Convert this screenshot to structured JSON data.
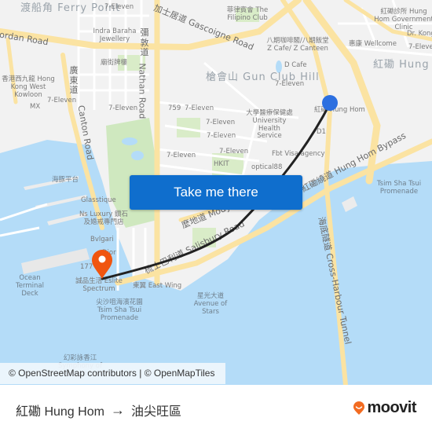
{
  "map": {
    "area_labels": [
      {
        "id": "ferry-point",
        "text": "渡船角 Ferry Point"
      },
      {
        "id": "gun-club-hill",
        "text": "槍會山 Gun Club Hill"
      },
      {
        "id": "hung-hom",
        "text": "紅磡 Hung Hom"
      }
    ],
    "road_labels": [
      {
        "id": "jordan-road",
        "text": "Jordan Road"
      },
      {
        "id": "gascoigne-road",
        "text": "加士居道 Gascoigne Road"
      },
      {
        "id": "nathan-road-cn",
        "text": "彌敦道"
      },
      {
        "id": "nathan-road",
        "text": "Nathan Road"
      },
      {
        "id": "canton-road-cn",
        "text": "廣東道"
      },
      {
        "id": "canton-road",
        "text": "Canton Road"
      },
      {
        "id": "hung-hom-bypass",
        "text": "紅磡繞道 Hung Hom Bypass"
      },
      {
        "id": "mody-road",
        "text": "麼地道 Mody Road"
      },
      {
        "id": "salisbury-road",
        "text": "梳士巴利道 Salisbury Road"
      },
      {
        "id": "cross-harbour-tunnel",
        "text": "海底隧道 Cross-Harbour Tunnel"
      }
    ],
    "poi_labels": [
      {
        "id": "7eleven-1",
        "text": "7-Eleven"
      },
      {
        "id": "indra",
        "text": "Indra Baraha Jewellery"
      },
      {
        "id": "temple-st",
        "text": "廟街牌樓"
      },
      {
        "id": "filipino-club",
        "text": "菲律賓會 The Filipino Club"
      },
      {
        "id": "z-cafe",
        "text": "八期咖啡閣/八期飯堂 Z Cafe/ Z Canteen"
      },
      {
        "id": "hung-hom-clinic",
        "text": "紅磡診所 Hung Hom Government Clinic"
      },
      {
        "id": "dr-kong",
        "text": "Dr. Kong"
      },
      {
        "id": "wellcome",
        "text": "惠康 Wellcome"
      },
      {
        "id": "7eleven-2",
        "text": "7-Eleven"
      },
      {
        "id": "d-cafe",
        "text": "D Cafe"
      },
      {
        "id": "7eleven-3",
        "text": "7-Eleven"
      },
      {
        "id": "hk-west-kowloon",
        "text": "香港西九龍 Hong Kong West Kowloon"
      },
      {
        "id": "7eleven-4",
        "text": "7-Eleven"
      },
      {
        "id": "mx",
        "text": "MX"
      },
      {
        "id": "7eleven-5",
        "text": "7-Eleven"
      },
      {
        "id": "759",
        "text": "759"
      },
      {
        "id": "7eleven-6",
        "text": "7-Eleven"
      },
      {
        "id": "uhs",
        "text": "大學醫療保健處 University Health Service"
      },
      {
        "id": "hung-hom-station",
        "text": "紅磡 Hung Hom"
      },
      {
        "id": "7eleven-7",
        "text": "7-Eleven"
      },
      {
        "id": "7eleven-8",
        "text": "7-Eleven"
      },
      {
        "id": "d1",
        "text": "D1"
      },
      {
        "id": "7eleven-9",
        "text": "7-Eleven"
      },
      {
        "id": "7eleven-10",
        "text": "7-Eleven"
      },
      {
        "id": "fbt-visa",
        "text": "Fbt Visa agency"
      },
      {
        "id": "hkit",
        "text": "HKIT"
      },
      {
        "id": "optical88",
        "text": "optical88"
      },
      {
        "id": "dolphin-terrace",
        "text": "海豚平台"
      },
      {
        "id": "glasstique",
        "text": "Glasstique"
      },
      {
        "id": "ns-luxury",
        "text": "Ns Luxury 鑽石及婚戒專門店"
      },
      {
        "id": "bvlgari",
        "text": "Bvlgari"
      },
      {
        "id": "dior",
        "text": "Dior"
      },
      {
        "id": "177",
        "text": "177"
      },
      {
        "id": "ocean-terminal",
        "text": "Ocean Terminal Deck"
      },
      {
        "id": "eslite",
        "text": "誠品生活 Eslite Spectrum"
      },
      {
        "id": "east-wing",
        "text": "東翼 East Wing"
      },
      {
        "id": "tst-promenade-1",
        "text": "尖沙咀海濱花園 Tsim Sha Tsui Promenade"
      },
      {
        "id": "avenue-of-stars",
        "text": "星光大道 Avenue of Stars"
      },
      {
        "id": "tst-promenade-2",
        "text": "Tsim Sha Tsui Promenade"
      },
      {
        "id": "symphony",
        "text": "幻彩詠香江 Symphony of Lights"
      }
    ],
    "origin_marker_color": "#2c6fe0",
    "destination_marker_color": "#f0550f",
    "route_color": "#222222"
  },
  "cta": {
    "label": "Take me there",
    "color": "#0f6ecd"
  },
  "attribution": "© OpenStreetMap contributors | © OpenMapTiles",
  "footer": {
    "origin": "紅磡 Hung Hom",
    "arrow": "→",
    "destination": "油尖旺區",
    "logo_text": "moovit",
    "logo_color": "#f26b21"
  }
}
